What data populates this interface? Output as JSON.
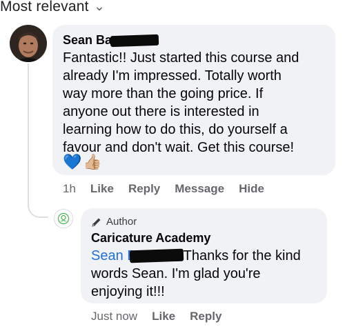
{
  "sort": {
    "label": "Most relevant"
  },
  "comment": {
    "author_visible": "Sean Ba",
    "text_lines": [
      "Fantastic!! Just started this course and",
      "already I'm impressed. Totally worth",
      "way more than the going price. If",
      "anyone out there is interested in",
      "learning how to do this, do yourself a",
      "favour and don't wait. Get this course!"
    ],
    "reactions": [
      "💙",
      "👍🏼"
    ],
    "meta": {
      "time": "1h",
      "like": "Like",
      "reply": "Reply",
      "message": "Message",
      "hide": "Hide"
    }
  },
  "reply": {
    "badge": "Author",
    "author": "Caricature Academy",
    "mention_visible": "Sean B",
    "text_line1": "Thanks for the kind",
    "text_line2": "words Sean.  I'm glad you're",
    "text_line3": "enjoying it!!!",
    "meta": {
      "time": "Just now",
      "like": "Like",
      "reply": "Reply"
    }
  },
  "colors": {
    "bubble": "#f0f2f5",
    "meta_text": "#65676b",
    "mention": "#216fdb",
    "thread_line": "#dcdfe4"
  }
}
